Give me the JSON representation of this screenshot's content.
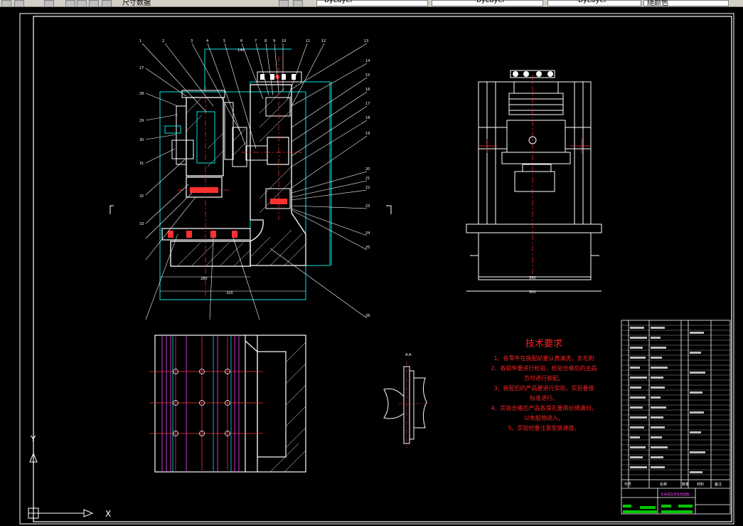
{
  "toolbar": {
    "layer_text": "尺寸数据",
    "combo1": "ByLayer",
    "combo2": "ByLayer",
    "combo3": "ByLayer",
    "combo4": "随颜色"
  },
  "drawing": {
    "tech_requirements_title": "技术要求",
    "tech_requirements": [
      "1、各零件在装配前要认真清洗，去毛刺",
      "2、各组件要进行检验，检验合格后的主品",
      "方可进行装配。",
      "3、装配后的产品要进行实验，实验要按",
      "标准进行。",
      "4、实验合格后产品各滑孔要用丝绸清扫，",
      "以免脏物进入。",
      "5、实验时要注意安装速度。"
    ],
    "section_label": "A-A",
    "dimension_labels": [
      "280",
      "320",
      "140",
      "350",
      "300"
    ],
    "balloon_numbers": [
      "1",
      "2",
      "3",
      "4",
      "5",
      "6",
      "7",
      "8",
      "9",
      "10",
      "11",
      "12",
      "13",
      "14",
      "15",
      "16",
      "17",
      "18",
      "19",
      "20",
      "21",
      "22",
      "23",
      "24",
      "25",
      "26",
      "27",
      "28",
      "29",
      "30",
      "31",
      "32",
      "33"
    ]
  },
  "title_block": {
    "header_cols": [
      "代号",
      "名称",
      "数量",
      "材料",
      "备注"
    ],
    "drawing_title": "车床液压夹具装配图"
  },
  "ucs": {
    "y_label": "Y",
    "x_label": "X"
  }
}
